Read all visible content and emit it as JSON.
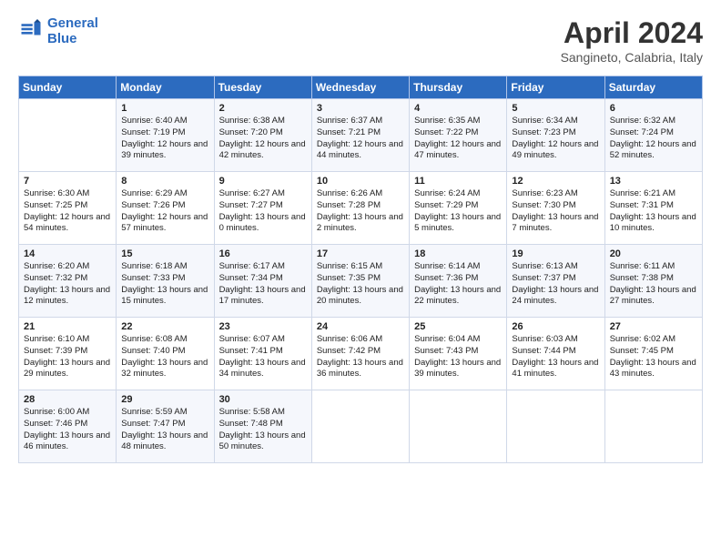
{
  "header": {
    "logo_line1": "General",
    "logo_line2": "Blue",
    "month_title": "April 2024",
    "subtitle": "Sangineto, Calabria, Italy"
  },
  "days_of_week": [
    "Sunday",
    "Monday",
    "Tuesday",
    "Wednesday",
    "Thursday",
    "Friday",
    "Saturday"
  ],
  "weeks": [
    [
      {
        "day": "",
        "sunrise": "",
        "sunset": "",
        "daylight": ""
      },
      {
        "day": "1",
        "sunrise": "Sunrise: 6:40 AM",
        "sunset": "Sunset: 7:19 PM",
        "daylight": "Daylight: 12 hours and 39 minutes."
      },
      {
        "day": "2",
        "sunrise": "Sunrise: 6:38 AM",
        "sunset": "Sunset: 7:20 PM",
        "daylight": "Daylight: 12 hours and 42 minutes."
      },
      {
        "day": "3",
        "sunrise": "Sunrise: 6:37 AM",
        "sunset": "Sunset: 7:21 PM",
        "daylight": "Daylight: 12 hours and 44 minutes."
      },
      {
        "day": "4",
        "sunrise": "Sunrise: 6:35 AM",
        "sunset": "Sunset: 7:22 PM",
        "daylight": "Daylight: 12 hours and 47 minutes."
      },
      {
        "day": "5",
        "sunrise": "Sunrise: 6:34 AM",
        "sunset": "Sunset: 7:23 PM",
        "daylight": "Daylight: 12 hours and 49 minutes."
      },
      {
        "day": "6",
        "sunrise": "Sunrise: 6:32 AM",
        "sunset": "Sunset: 7:24 PM",
        "daylight": "Daylight: 12 hours and 52 minutes."
      }
    ],
    [
      {
        "day": "7",
        "sunrise": "Sunrise: 6:30 AM",
        "sunset": "Sunset: 7:25 PM",
        "daylight": "Daylight: 12 hours and 54 minutes."
      },
      {
        "day": "8",
        "sunrise": "Sunrise: 6:29 AM",
        "sunset": "Sunset: 7:26 PM",
        "daylight": "Daylight: 12 hours and 57 minutes."
      },
      {
        "day": "9",
        "sunrise": "Sunrise: 6:27 AM",
        "sunset": "Sunset: 7:27 PM",
        "daylight": "Daylight: 13 hours and 0 minutes."
      },
      {
        "day": "10",
        "sunrise": "Sunrise: 6:26 AM",
        "sunset": "Sunset: 7:28 PM",
        "daylight": "Daylight: 13 hours and 2 minutes."
      },
      {
        "day": "11",
        "sunrise": "Sunrise: 6:24 AM",
        "sunset": "Sunset: 7:29 PM",
        "daylight": "Daylight: 13 hours and 5 minutes."
      },
      {
        "day": "12",
        "sunrise": "Sunrise: 6:23 AM",
        "sunset": "Sunset: 7:30 PM",
        "daylight": "Daylight: 13 hours and 7 minutes."
      },
      {
        "day": "13",
        "sunrise": "Sunrise: 6:21 AM",
        "sunset": "Sunset: 7:31 PM",
        "daylight": "Daylight: 13 hours and 10 minutes."
      }
    ],
    [
      {
        "day": "14",
        "sunrise": "Sunrise: 6:20 AM",
        "sunset": "Sunset: 7:32 PM",
        "daylight": "Daylight: 13 hours and 12 minutes."
      },
      {
        "day": "15",
        "sunrise": "Sunrise: 6:18 AM",
        "sunset": "Sunset: 7:33 PM",
        "daylight": "Daylight: 13 hours and 15 minutes."
      },
      {
        "day": "16",
        "sunrise": "Sunrise: 6:17 AM",
        "sunset": "Sunset: 7:34 PM",
        "daylight": "Daylight: 13 hours and 17 minutes."
      },
      {
        "day": "17",
        "sunrise": "Sunrise: 6:15 AM",
        "sunset": "Sunset: 7:35 PM",
        "daylight": "Daylight: 13 hours and 20 minutes."
      },
      {
        "day": "18",
        "sunrise": "Sunrise: 6:14 AM",
        "sunset": "Sunset: 7:36 PM",
        "daylight": "Daylight: 13 hours and 22 minutes."
      },
      {
        "day": "19",
        "sunrise": "Sunrise: 6:13 AM",
        "sunset": "Sunset: 7:37 PM",
        "daylight": "Daylight: 13 hours and 24 minutes."
      },
      {
        "day": "20",
        "sunrise": "Sunrise: 6:11 AM",
        "sunset": "Sunset: 7:38 PM",
        "daylight": "Daylight: 13 hours and 27 minutes."
      }
    ],
    [
      {
        "day": "21",
        "sunrise": "Sunrise: 6:10 AM",
        "sunset": "Sunset: 7:39 PM",
        "daylight": "Daylight: 13 hours and 29 minutes."
      },
      {
        "day": "22",
        "sunrise": "Sunrise: 6:08 AM",
        "sunset": "Sunset: 7:40 PM",
        "daylight": "Daylight: 13 hours and 32 minutes."
      },
      {
        "day": "23",
        "sunrise": "Sunrise: 6:07 AM",
        "sunset": "Sunset: 7:41 PM",
        "daylight": "Daylight: 13 hours and 34 minutes."
      },
      {
        "day": "24",
        "sunrise": "Sunrise: 6:06 AM",
        "sunset": "Sunset: 7:42 PM",
        "daylight": "Daylight: 13 hours and 36 minutes."
      },
      {
        "day": "25",
        "sunrise": "Sunrise: 6:04 AM",
        "sunset": "Sunset: 7:43 PM",
        "daylight": "Daylight: 13 hours and 39 minutes."
      },
      {
        "day": "26",
        "sunrise": "Sunrise: 6:03 AM",
        "sunset": "Sunset: 7:44 PM",
        "daylight": "Daylight: 13 hours and 41 minutes."
      },
      {
        "day": "27",
        "sunrise": "Sunrise: 6:02 AM",
        "sunset": "Sunset: 7:45 PM",
        "daylight": "Daylight: 13 hours and 43 minutes."
      }
    ],
    [
      {
        "day": "28",
        "sunrise": "Sunrise: 6:00 AM",
        "sunset": "Sunset: 7:46 PM",
        "daylight": "Daylight: 13 hours and 46 minutes."
      },
      {
        "day": "29",
        "sunrise": "Sunrise: 5:59 AM",
        "sunset": "Sunset: 7:47 PM",
        "daylight": "Daylight: 13 hours and 48 minutes."
      },
      {
        "day": "30",
        "sunrise": "Sunrise: 5:58 AM",
        "sunset": "Sunset: 7:48 PM",
        "daylight": "Daylight: 13 hours and 50 minutes."
      },
      {
        "day": "",
        "sunrise": "",
        "sunset": "",
        "daylight": ""
      },
      {
        "day": "",
        "sunrise": "",
        "sunset": "",
        "daylight": ""
      },
      {
        "day": "",
        "sunrise": "",
        "sunset": "",
        "daylight": ""
      },
      {
        "day": "",
        "sunrise": "",
        "sunset": "",
        "daylight": ""
      }
    ]
  ]
}
